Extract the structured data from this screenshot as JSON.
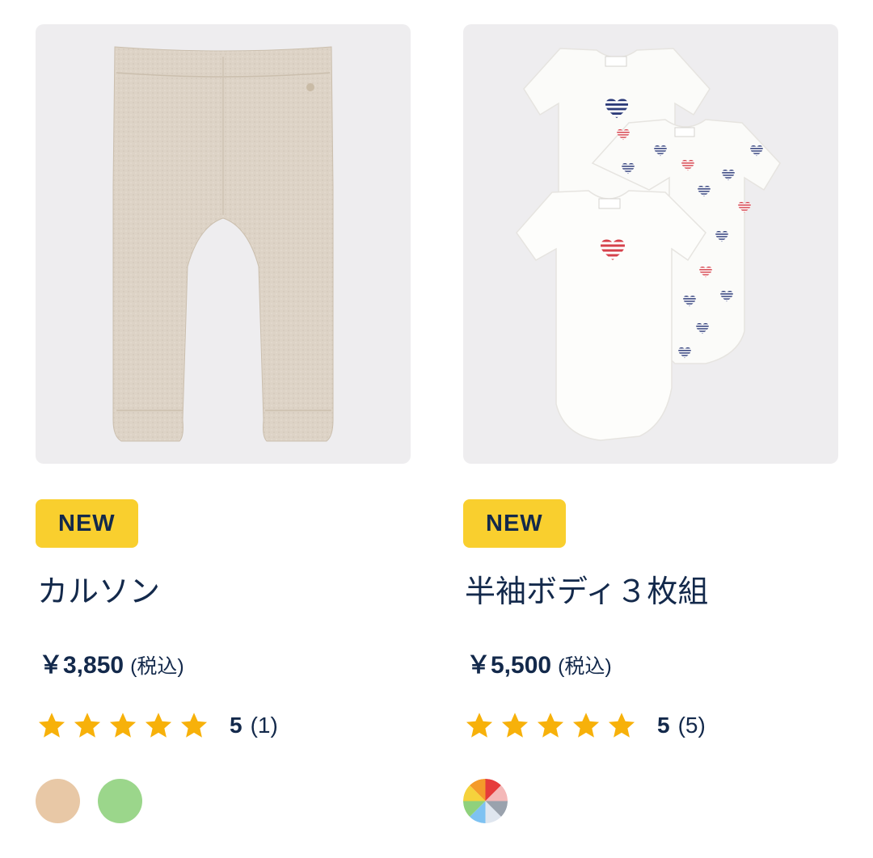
{
  "products": [
    {
      "badge": "NEW",
      "name": "カルソン",
      "price": "￥3,850",
      "tax_label": "(税込)",
      "rating": {
        "stars": 5,
        "value": "5",
        "count": "(1)"
      },
      "swatches": [
        {
          "name": "beige-swatch",
          "color": "#e8c8a6"
        },
        {
          "name": "green-swatch",
          "color": "#9bd68b"
        }
      ]
    },
    {
      "badge": "NEW",
      "name": "半袖ボディ３枚組",
      "price": "￥5,500",
      "tax_label": "(税込)",
      "rating": {
        "stars": 5,
        "value": "5",
        "count": "(5)"
      },
      "swatches": [
        {
          "name": "multicolor-swatch",
          "color": "multicolor"
        }
      ]
    }
  ],
  "colors": {
    "badge_bg": "#f9cf2e",
    "text": "#13294b",
    "star": "#f7b10a",
    "image_bg": "#eeedef"
  }
}
